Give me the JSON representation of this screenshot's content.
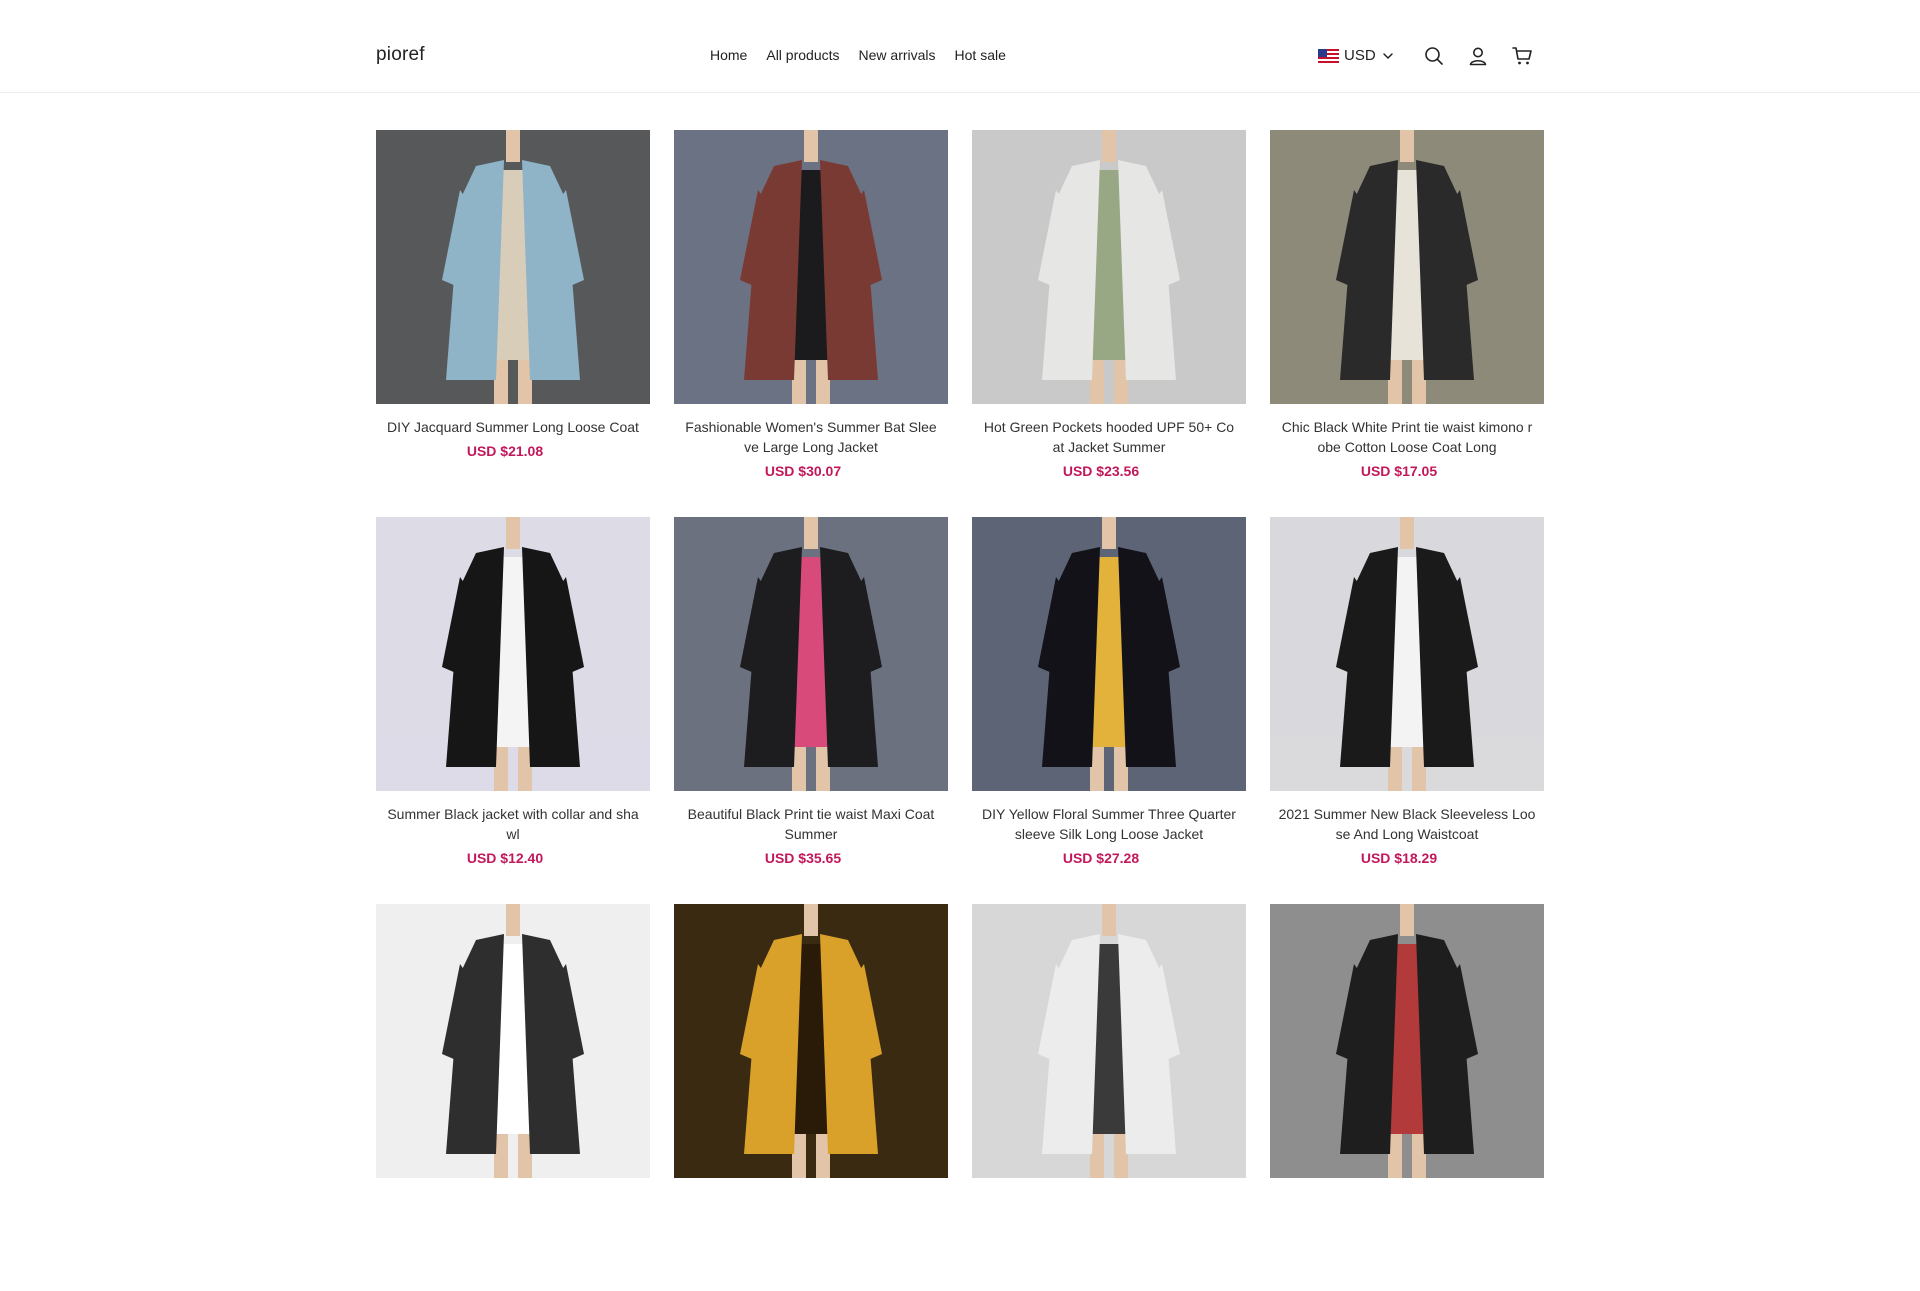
{
  "header": {
    "logo": "pioref",
    "nav": [
      "Home",
      "All products",
      "New arrivals",
      "Hot sale"
    ],
    "currency": "USD",
    "icons": [
      "search-icon",
      "account-icon",
      "cart-icon"
    ]
  },
  "products": [
    {
      "title": "DIY Jacquard Summer Long Loose Coat",
      "price": "USD $21.08",
      "colors": {
        "bg": "#57585a",
        "garment": "#8fb4c7",
        "accent": "#d8cdb8"
      }
    },
    {
      "title": "Fashionable Women's Summer Bat Slee ve Large Long Jacket",
      "price": "USD $30.07",
      "colors": {
        "bg": "#6b7284",
        "garment": "#7a3a34",
        "accent": "#1b1b1e"
      }
    },
    {
      "title": "Hot Green Pockets hooded UPF 50+ Co at Jacket Summer",
      "price": "USD $23.56",
      "colors": {
        "bg": "#c9c9c9",
        "garment": "#e6e6e4",
        "accent": "#98a784"
      }
    },
    {
      "title": "Chic Black White Print tie waist kimono r obe Cotton Loose Coat Long",
      "price": "USD $17.05",
      "colors": {
        "bg": "#8d8a7a",
        "garment": "#2a2a2a",
        "accent": "#e7e3d8"
      }
    },
    {
      "title": "Summer Black jacket with collar and sha wl",
      "price": "USD $12.40",
      "colors": {
        "bg": "#dcdbe6",
        "garment": "#161616",
        "accent": "#f4f4f4"
      }
    },
    {
      "title": "Beautiful Black Print tie waist Maxi Coat Summer",
      "price": "USD $35.65",
      "colors": {
        "bg": "#6c7180",
        "garment": "#1d1d20",
        "accent": "#d74a7a"
      }
    },
    {
      "title": "DIY Yellow Floral Summer Three Quarter sleeve Silk Long Loose Jacket",
      "price": "USD $27.28",
      "colors": {
        "bg": "#5d6475",
        "garment": "#121218",
        "accent": "#e3b23a"
      }
    },
    {
      "title": "2021 Summer New Black Sleeveless Loo se And Long Waistcoat",
      "price": "USD $18.29",
      "colors": {
        "bg": "#d9d9dd",
        "garment": "#1a1a1a",
        "accent": "#f3f3f3"
      }
    },
    {
      "title": "",
      "price": "",
      "colors": {
        "bg": "#efefef",
        "garment": "#2e2e2e",
        "accent": "#ffffff"
      }
    },
    {
      "title": "",
      "price": "",
      "colors": {
        "bg": "#3a2a12",
        "garment": "#d9a12a",
        "accent": "#2a1a08"
      }
    },
    {
      "title": "",
      "price": "",
      "colors": {
        "bg": "#d7d7d7",
        "garment": "#ececec",
        "accent": "#3a3a3a"
      }
    },
    {
      "title": "",
      "price": "",
      "colors": {
        "bg": "#8e8e8e",
        "garment": "#1e1e1e",
        "accent": "#b23a3a"
      }
    }
  ]
}
